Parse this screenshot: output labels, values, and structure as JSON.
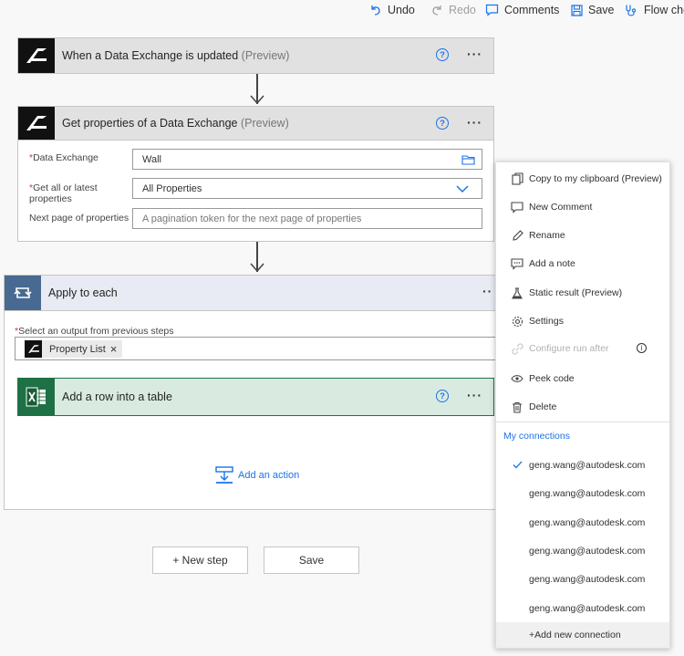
{
  "toolbar": {
    "undo": "Undo",
    "redo": "Redo",
    "comments": "Comments",
    "save": "Save",
    "flow_checker": "Flow che"
  },
  "trigger": {
    "title": "When a Data Exchange is updated",
    "tag": "(Preview)"
  },
  "get_props": {
    "title": "Get properties of a Data Exchange",
    "tag": "(Preview)",
    "fields": {
      "data_exchange_label": "Data Exchange",
      "data_exchange_value": "Wall",
      "all_or_latest_label_1": "Get all or latest",
      "all_or_latest_label_2": "properties",
      "all_or_latest_value": "All Properties",
      "next_page_label": "Next page of properties",
      "next_page_placeholder": "A pagination token for the next page of properties"
    }
  },
  "apply_each": {
    "title": "Apply to each",
    "select_label": "Select an output from previous steps",
    "token": "Property List",
    "token_remove": "×"
  },
  "excel_action": {
    "title": "Add a row into a table"
  },
  "add_action": "Add an action",
  "buttons": {
    "new_step": "+ New step",
    "save": "Save"
  },
  "menu": {
    "items": [
      {
        "label": "Copy to my clipboard (Preview)",
        "icon": "copy-icon"
      },
      {
        "label": "New Comment",
        "icon": "comment-icon"
      },
      {
        "label": "Rename",
        "icon": "pencil-icon"
      },
      {
        "label": "Add a note",
        "icon": "note-icon"
      },
      {
        "label": "Static result (Preview)",
        "icon": "flask-icon"
      },
      {
        "label": "Settings",
        "icon": "gear-icon"
      },
      {
        "label": "Configure run after",
        "icon": "link-icon",
        "disabled": true
      },
      {
        "label": "Peek code",
        "icon": "eye-icon"
      },
      {
        "label": "Delete",
        "icon": "trash-icon"
      }
    ],
    "connections_header": "My connections",
    "connections": [
      "geng.wang@autodesk.com",
      "geng.wang@autodesk.com",
      "geng.wang@autodesk.com",
      "geng.wang@autodesk.com",
      "geng.wang@autodesk.com",
      "geng.wang@autodesk.com"
    ],
    "add_connection": "+Add new connection"
  },
  "colors": {
    "accent": "#1a73e8",
    "excel_green": "#1e7145",
    "apply_blue": "#486991"
  }
}
